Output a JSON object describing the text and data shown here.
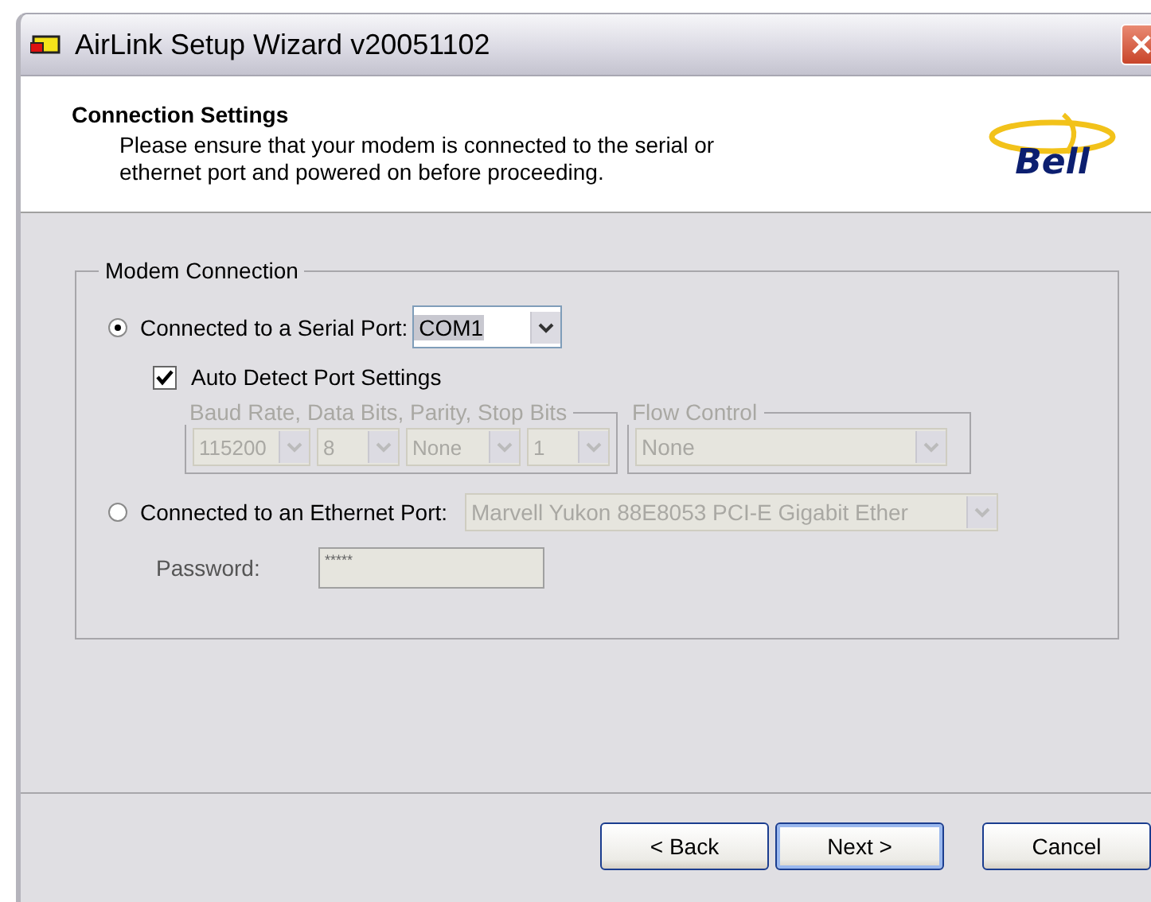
{
  "window": {
    "title": "AirLink Setup Wizard v20051102"
  },
  "header": {
    "title": "Connection Settings",
    "description": "Please ensure that your modem is connected to the serial or\nethernet port and powered on before proceeding.",
    "logo_text": "Bell"
  },
  "modem_connection": {
    "legend": "Modem Connection",
    "serial": {
      "label": "Connected to a Serial Port:",
      "selected": true,
      "port": {
        "value": "COM1",
        "disabled": false
      }
    },
    "auto_detect": {
      "label": "Auto Detect Port Settings",
      "checked": true
    },
    "port_settings": {
      "legend": "Baud Rate, Data Bits, Parity, Stop Bits",
      "disabled": true,
      "fields": [
        {
          "value": "115200"
        },
        {
          "value": "8"
        },
        {
          "value": "None"
        },
        {
          "value": "1"
        }
      ]
    },
    "flow_control": {
      "legend": "Flow Control",
      "value": "None",
      "disabled": true
    },
    "ethernet": {
      "label": "Connected to an Ethernet Port:",
      "selected": false,
      "adapter": {
        "value": "Marvell Yukon 88E8053 PCI-E Gigabit Ether",
        "disabled": true
      }
    },
    "password": {
      "label": "Password:",
      "value": "*****",
      "disabled": true
    }
  },
  "buttons": [
    {
      "label": "< Back",
      "default": false
    },
    {
      "label": "Next >",
      "default": true
    },
    {
      "label": "Cancel",
      "default": false
    }
  ]
}
